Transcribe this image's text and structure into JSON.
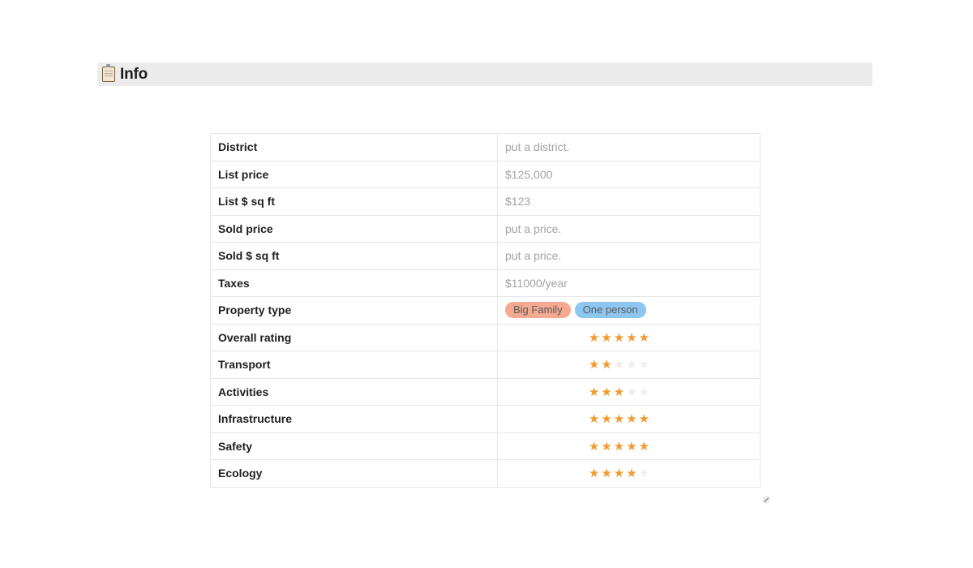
{
  "header": {
    "title": "Info",
    "icon": "clipboard-icon"
  },
  "colors": {
    "star_filled": "#f19a2e",
    "star_empty": "#eeeeee"
  },
  "rows": [
    {
      "label": "District",
      "value": "put a district."
    },
    {
      "label": "List price",
      "value": "$125,000"
    },
    {
      "label": "List $ sq ft",
      "value": "$123"
    },
    {
      "label": "Sold price",
      "value": "put a price."
    },
    {
      "label": "Sold $ sq ft",
      "value": "put a price."
    },
    {
      "label": "Taxes",
      "value": "$11000/year"
    }
  ],
  "property_type": {
    "label": "Property type",
    "tags": [
      {
        "text": "Big Family",
        "color": "#f4a990"
      },
      {
        "text": "One person",
        "color": "#8ec6f2"
      }
    ]
  },
  "ratings": [
    {
      "label": "Overall rating",
      "stars": 5,
      "max": 5
    },
    {
      "label": "Transport",
      "stars": 2,
      "max": 5
    },
    {
      "label": "Activities",
      "stars": 3,
      "max": 5
    },
    {
      "label": "Infrastructure",
      "stars": 5,
      "max": 5
    },
    {
      "label": "Safety",
      "stars": 5,
      "max": 5
    },
    {
      "label": "Ecology",
      "stars": 4,
      "max": 5
    }
  ]
}
